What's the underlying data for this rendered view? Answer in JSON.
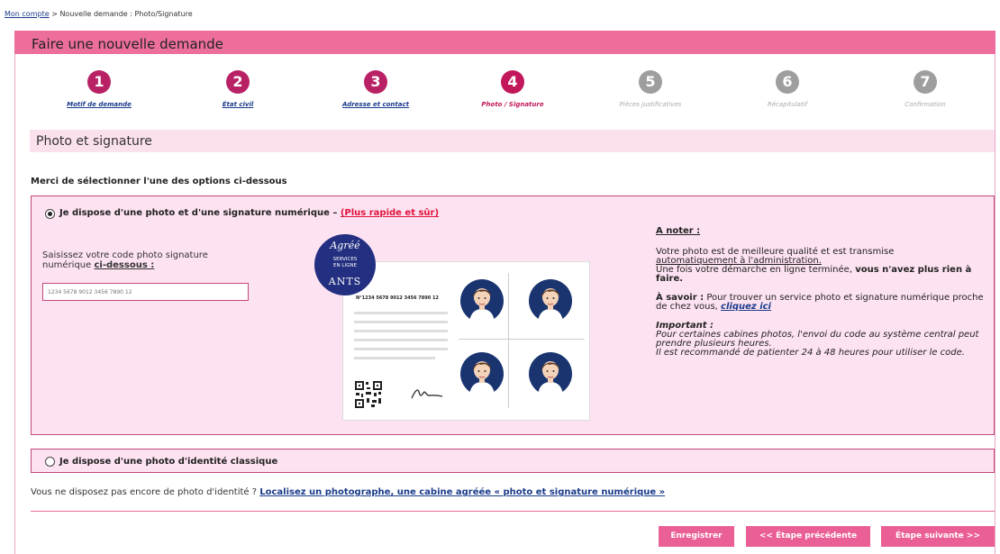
{
  "breadcrumb": {
    "home": "Mon compte",
    "separator": ">",
    "current": "Nouvelle demande : Photo/Signature"
  },
  "header": {
    "title": "Faire une nouvelle demande"
  },
  "steps": [
    {
      "num": "1",
      "label": "Motif de demande",
      "state": "done"
    },
    {
      "num": "2",
      "label": "État civil",
      "state": "done"
    },
    {
      "num": "3",
      "label": "Adresse et contact",
      "state": "done"
    },
    {
      "num": "4",
      "label": "Photo / Signature",
      "state": "current"
    },
    {
      "num": "5",
      "label": "Pièces justificatives",
      "state": "todo"
    },
    {
      "num": "6",
      "label": "Récapitulatif",
      "state": "todo"
    },
    {
      "num": "7",
      "label": "Confirmation",
      "state": "todo"
    }
  ],
  "section": {
    "title": "Photo et signature"
  },
  "select_label": "Merci de sélectionner l'une des options ci-dessous",
  "option1": {
    "label": "Je dispose d'une photo et d'une signature numérique –",
    "fast": "(Plus rapide et sûr)",
    "code_label_1": "Saisissez votre code photo signature",
    "code_label_2": "numérique",
    "code_label_3": "ci-dessous :",
    "code_placeholder": "1234 5678 9012 3456 7890 12",
    "card_code": "N°1234 5678 9012 3456 7890 12",
    "seal": {
      "top": "Agréé",
      "mid1": "SERVICES",
      "mid2": "EN LIGNE",
      "bottom": "ANTS"
    },
    "notes": {
      "heading": "A noter :",
      "p1a": "Votre photo est de meilleure qualité et est transmise",
      "p1b": "automatiquement à l'administration.",
      "p1c": "Une fois votre démarche en ligne terminée,",
      "p1d": "vous n'avez plus rien à faire.",
      "savoir_lbl": "À savoir :",
      "savoir_txt": "Pour trouver un service photo et signature numérique proche de chez vous,",
      "savoir_link": "cliquez ici",
      "important_lbl": "Important :",
      "imp1": "Pour certaines cabines photos, l'envoi du code au système central peut prendre plusieurs heures.",
      "imp2": "Il est recommandé de patienter 24 à 48 heures pour utiliser le code."
    }
  },
  "option2": {
    "label": "Je dispose d'une photo d'identité classique"
  },
  "no_photo": {
    "text": "Vous ne disposez pas encore de photo d'identité ?",
    "link": "Localisez un photographe, une cabine agréée « photo et signature numérique »"
  },
  "buttons": {
    "save": "Enregistrer",
    "prev": "<< Étape précédente",
    "next": "Étape suivante >>"
  },
  "colors": {
    "header": "#ed6e9d",
    "step_done": "#b82265",
    "step_current": "#c2185b",
    "step_todo": "#9e9e9e",
    "panel": "#fde2f1",
    "button": "#ea5f95",
    "face_bg": "#1a3470"
  }
}
